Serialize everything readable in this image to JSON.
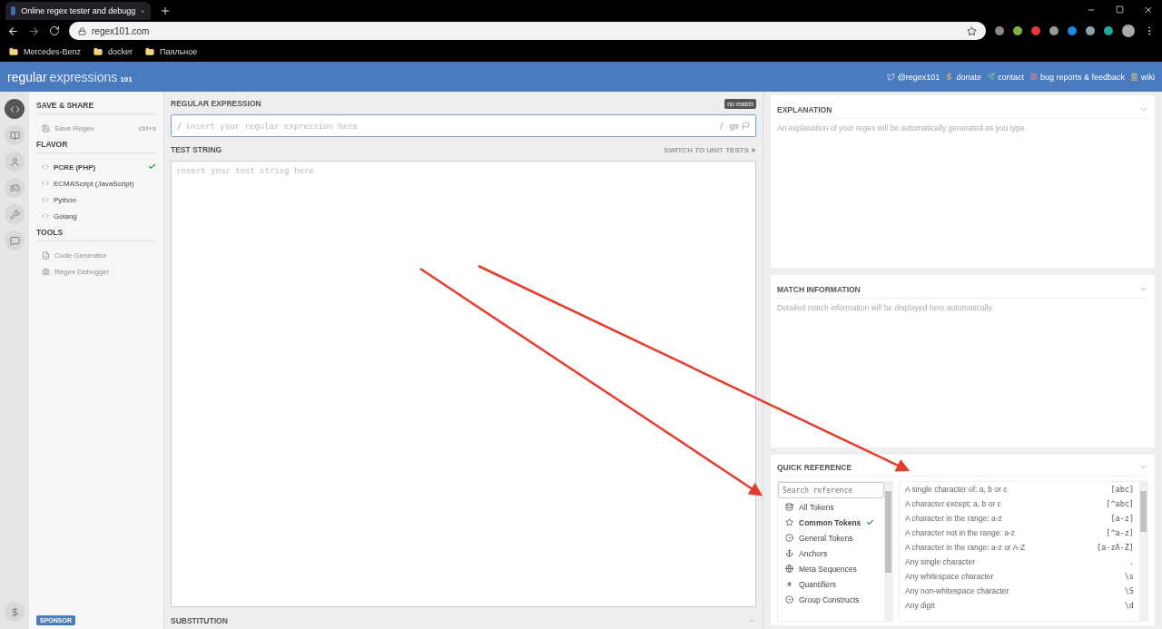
{
  "browser": {
    "tab_title": "Online regex tester and debugg",
    "url": "regex101.com",
    "bookmarks": [
      "Mercedes-Benz",
      "docker",
      "Паяльное"
    ]
  },
  "header": {
    "logo_main": "regular",
    "logo_sub": "expressions",
    "logo_num": "101",
    "links": [
      "@regex101",
      "donate",
      "contact",
      "bug reports & feedback",
      "wiki"
    ]
  },
  "icon_rail": [
    {
      "selected": true
    },
    {
      "selected": false
    },
    {
      "selected": false
    },
    {
      "selected": false
    },
    {
      "selected": false
    },
    {
      "selected": false
    }
  ],
  "sidebar": {
    "save_title": "SAVE & SHARE",
    "save_item": {
      "label": "Save Regex",
      "shortcut": "ctrl+s",
      "disabled": true
    },
    "flavor_title": "FLAVOR",
    "flavors": [
      {
        "label": "PCRE (PHP)",
        "selected": true
      },
      {
        "label": "ECMAScript (JavaScript)",
        "selected": false
      },
      {
        "label": "Python",
        "selected": false
      },
      {
        "label": "Golang",
        "selected": false
      }
    ],
    "tools_title": "TOOLS",
    "tools": [
      {
        "label": "Code Generator",
        "disabled": true
      },
      {
        "label": "Regex Debugger",
        "disabled": true
      }
    ],
    "sponsor": "SPONSOR"
  },
  "editor": {
    "regex_title": "REGULAR EXPRESSION",
    "match_badge": "no match",
    "delimiter_open": "/",
    "regex_placeholder": "insert your regular expression here",
    "delimiter_close": "/",
    "flags": "gm",
    "test_title": "TEST STRING",
    "unit_tests_link": "SWITCH TO UNIT TESTS",
    "test_placeholder": "insert your test string here",
    "substitution_title": "SUBSTITUTION"
  },
  "explanation": {
    "title": "EXPLANATION",
    "text": "An explanation of your regex will be automatically generated as you type."
  },
  "match_info": {
    "title": "MATCH INFORMATION",
    "text": "Detailed match information will be displayed here automatically."
  },
  "quick_reference": {
    "title": "QUICK REFERENCE",
    "search_placeholder": "Search reference",
    "categories": [
      {
        "label": "All Tokens",
        "selected": false
      },
      {
        "label": "Common Tokens",
        "selected": true
      },
      {
        "label": "General Tokens",
        "selected": false
      },
      {
        "label": "Anchors",
        "selected": false
      },
      {
        "label": "Meta Sequences",
        "selected": false
      },
      {
        "label": "Quantifiers",
        "selected": false
      },
      {
        "label": "Group Constructs",
        "selected": false
      }
    ],
    "tokens": [
      {
        "description": "A single character of: a, b or c",
        "token": "[abc]"
      },
      {
        "description": "A character except: a, b or c",
        "token": "[^abc]"
      },
      {
        "description": "A character in the range: a-z",
        "token": "[a-z]"
      },
      {
        "description": "A character not in the range: a-z",
        "token": "[^a-z]"
      },
      {
        "description": "A character in the range: a-z or A-Z",
        "token": "[a-zA-Z]"
      },
      {
        "description": "Any single character",
        "token": "."
      },
      {
        "description": "Any whitespace character",
        "token": "\\s"
      },
      {
        "description": "Any non-whitespace character",
        "token": "\\S"
      },
      {
        "description": "Any digit",
        "token": "\\d"
      }
    ]
  }
}
